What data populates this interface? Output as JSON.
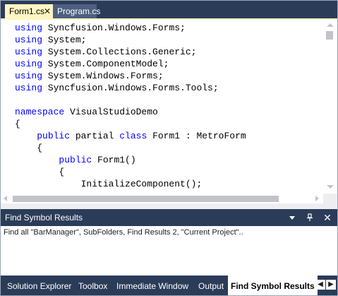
{
  "document_tabs": [
    {
      "label": "Form1.cs",
      "active": true
    },
    {
      "label": "Program.cs",
      "active": false
    }
  ],
  "tab_close_glyph": "✕",
  "code": [
    [
      {
        "t": "using",
        "k": true
      },
      {
        "t": " Syncfusion.Windows.Forms;",
        "k": false
      }
    ],
    [
      {
        "t": "using",
        "k": true
      },
      {
        "t": " System;",
        "k": false
      }
    ],
    [
      {
        "t": "using",
        "k": true
      },
      {
        "t": " System.Collections.Generic;",
        "k": false
      }
    ],
    [
      {
        "t": "using",
        "k": true
      },
      {
        "t": " System.ComponentModel;",
        "k": false
      }
    ],
    [
      {
        "t": "using",
        "k": true
      },
      {
        "t": " System.Windows.Forms;",
        "k": false
      }
    ],
    [
      {
        "t": "using",
        "k": true
      },
      {
        "t": " Syncfusion.Windows.Forms.Tools;",
        "k": false
      }
    ],
    [],
    [
      {
        "t": "namespace",
        "k": true
      },
      {
        "t": " VisualStudioDemo",
        "k": false
      }
    ],
    [
      {
        "t": "{",
        "k": false
      }
    ],
    [
      {
        "t": "    ",
        "k": false
      },
      {
        "t": "public",
        "k": true
      },
      {
        "t": " partial ",
        "k": false
      },
      {
        "t": "class",
        "k": true
      },
      {
        "t": " Form1 : MetroForm",
        "k": false
      }
    ],
    [
      {
        "t": "    {",
        "k": false
      }
    ],
    [
      {
        "t": "        ",
        "k": false
      },
      {
        "t": "public",
        "k": true
      },
      {
        "t": " Form1()",
        "k": false
      }
    ],
    [
      {
        "t": "        {",
        "k": false
      }
    ],
    [
      {
        "t": "            InitializeComponent();",
        "k": false
      }
    ]
  ],
  "tool_window": {
    "title": "Find Symbol Results",
    "dropdown_icon": "▼",
    "pin_icon": "📌",
    "close_icon": "✕",
    "result_text": "Find all \"BarManager\", SubFolders, Find Results 2, \"Current Project\".."
  },
  "bottom_tabs": [
    {
      "label": "Solution Explorer",
      "active": false
    },
    {
      "label": "Toolbox",
      "active": false
    },
    {
      "label": "Immediate Window",
      "active": false
    },
    {
      "label": "Output",
      "active": false
    },
    {
      "label": "Find Symbol Results",
      "active": true
    }
  ],
  "nav_prev_glyph": "◀",
  "nav_next_glyph": "▶",
  "colors": {
    "chrome": "#2b3c59",
    "active_doc_tab": "#fff6c2",
    "keyword": "#0000ff"
  }
}
